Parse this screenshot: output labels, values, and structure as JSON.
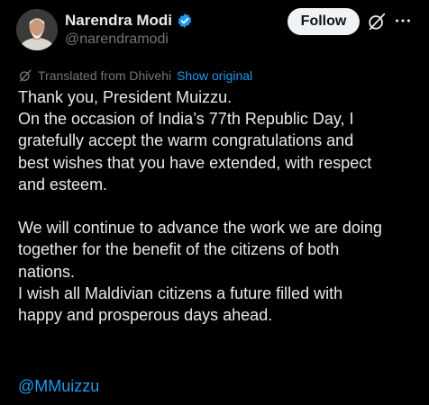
{
  "author": {
    "name": "Narendra Modi",
    "handle": "@narendramodi",
    "verified_color": "#1d9bf0"
  },
  "actions": {
    "follow_label": "Follow",
    "grok_icon": "grok-icon",
    "more_icon": "more-options-icon"
  },
  "translation": {
    "label": "Translated from Dhivehi",
    "show_original": "Show original"
  },
  "post": {
    "lines": [
      "Thank you, President Muizzu.",
      "On the occasion of India’s 77th Republic Day, I",
      "gratefully accept the warm congratulations and",
      "best wishes that you have extended, with respect",
      "and esteem.",
      "We will continue to advance the work we are doing",
      "together for the benefit of the citizens of both",
      "nations.",
      "I wish all Maldivian citizens a future filled with",
      "happy and prosperous days ahead."
    ],
    "mention": "@MMuizzu"
  },
  "colors": {
    "background": "#000000",
    "text": "#e7e9ea",
    "secondary": "#71767b",
    "link": "#1d9bf0"
  }
}
